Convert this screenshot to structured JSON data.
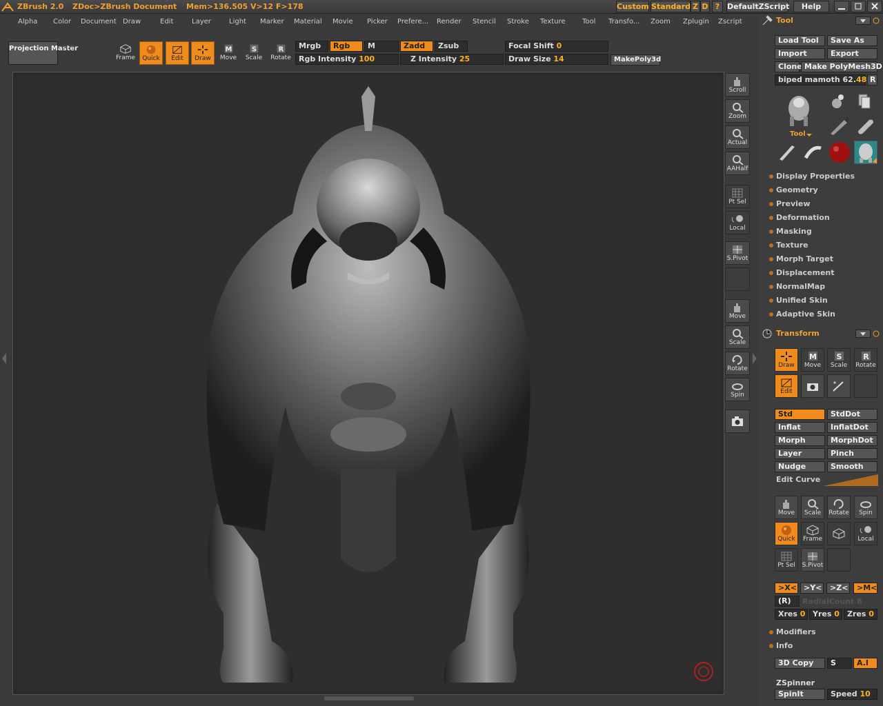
{
  "titlebar": {
    "app": "ZBrush 2.0",
    "doc": "ZDoc>ZBrush Document",
    "mem": "Mem>136.505 V>12 F>178",
    "custom": "Custom",
    "standard": "Standard",
    "z": "Z",
    "d": "D",
    "q": "?",
    "script": "DefaultZScript",
    "help": "Help"
  },
  "menu": [
    "Alpha",
    "Color",
    "Document",
    "Draw",
    "Edit",
    "Layer",
    "Light",
    "Marker",
    "Material",
    "Movie",
    "Picker",
    "Prefere...",
    "Render",
    "Stencil",
    "Stroke",
    "Texture",
    "Tool",
    "Transfo...",
    "Zoom",
    "Zplugin",
    "Zscript"
  ],
  "toolbar": {
    "projection_master": "Projection Master",
    "frame": "Frame",
    "quick": "Quick",
    "edit": "Edit",
    "draw": "Draw",
    "move": "Move",
    "scale": "Scale",
    "rotate": "Rotate",
    "mrgb": "Mrgb",
    "rgb": "Rgb",
    "m": "M",
    "zadd": "Zadd",
    "zsub": "Zsub",
    "rgb_intensity_label": "Rgb Intensity",
    "rgb_intensity": "100",
    "z_intensity_label": "Z Intensity",
    "z_intensity": "25",
    "focal_shift_label": "Focal Shift",
    "focal_shift": "0",
    "draw_size_label": "Draw Size",
    "draw_size": "14",
    "make_poly": "MakePoly3d"
  },
  "shelf": [
    "Scroll",
    "Zoom",
    "Actual",
    "AAHalf",
    "Pt Sel",
    "Local",
    "S.Pivot",
    "Move",
    "Scale",
    "Rotate",
    "Spin"
  ],
  "tool": {
    "title": "Tool",
    "load_tool": "Load Tool",
    "save_as": "Save As",
    "import": "Import",
    "export": "Export",
    "clone": "Clone",
    "make_polymesh": "Make PolyMesh3D",
    "current_tool": "biped mamoth",
    "current_value": "62.",
    "current_value_highlight": "48",
    "r": "R",
    "tool_label": "Tool",
    "subpalettes": [
      "Display Properties",
      "Geometry",
      "Preview",
      "Deformation",
      "Masking",
      "Texture",
      "Morph Target",
      "Displacement",
      "NormalMap",
      "Unified Skin",
      "Adaptive Skin"
    ]
  },
  "transform": {
    "title": "Transform",
    "draw": "Draw",
    "move": "Move",
    "scale": "Scale",
    "rotate": "Rotate",
    "edit": "Edit",
    "brushes": [
      [
        "Std",
        "StdDot"
      ],
      [
        "Inflat",
        "InflatDot"
      ],
      [
        "Morph",
        "MorphDot"
      ],
      [
        "Layer",
        "Pinch"
      ],
      [
        "Nudge",
        "Smooth"
      ]
    ],
    "edit_curve": "Edit Curve",
    "move2": "Move",
    "scale2": "Scale",
    "rotate2": "Rotate",
    "spin": "Spin",
    "quick": "Quick",
    "frame": "Frame",
    "local": "Local",
    "pt_sel": "Pt Sel",
    "s_pivot": "S.Pivot",
    "x_sym": ">X<",
    "y_sym": ">Y<",
    "z_sym": ">Z<",
    "m_sym": ">M<",
    "r_sym": "(R)",
    "radial_count": "RadialCount",
    "radial_value": "8",
    "xres_label": "Xres",
    "xres": "0",
    "yres_label": "Yres",
    "yres": "0",
    "zres_label": "Zres",
    "zres": "0",
    "modifiers": "Modifiers",
    "info": "Info",
    "copy3d": "3D Copy",
    "s": "S",
    "ai": "A.I",
    "zspinner": "ZSpinner",
    "spinit": "SpinIt",
    "speed_label": "Speed",
    "speed": "10"
  }
}
